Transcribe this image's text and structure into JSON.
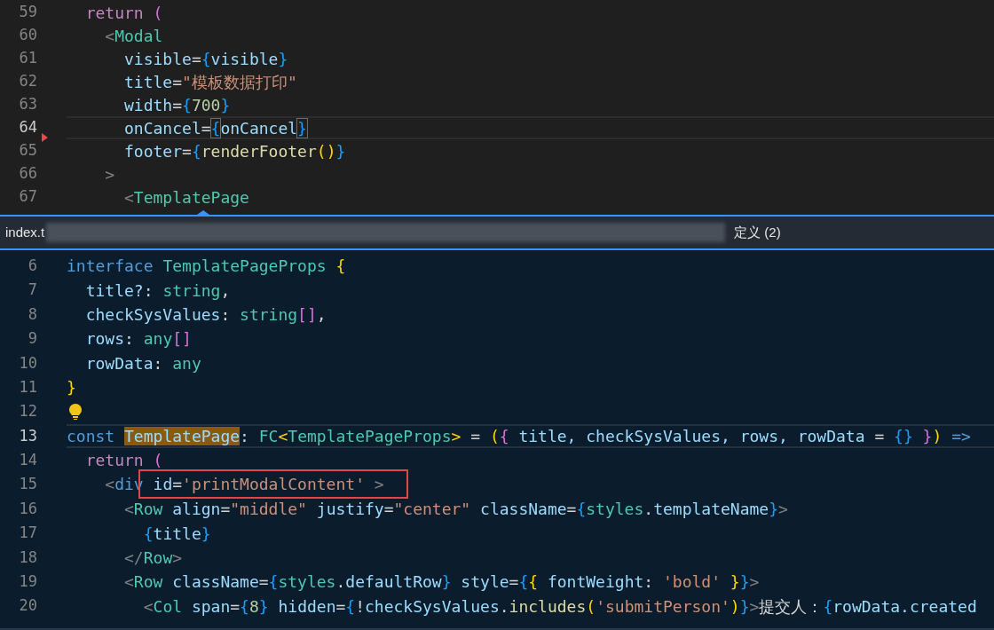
{
  "top_editor": {
    "lines": [
      {
        "number": "59",
        "current": false,
        "tokens": [
          {
            "text": "  return",
            "kind": "kw"
          },
          {
            "text": " (",
            "kind": "b2"
          }
        ]
      },
      {
        "number": "60",
        "current": false,
        "tokens": [
          {
            "text": "    <",
            "kind": "punct"
          },
          {
            "text": "Modal",
            "kind": "tag"
          }
        ]
      },
      {
        "number": "61",
        "current": false,
        "tokens": [
          {
            "text": "      visible",
            "kind": "attr"
          },
          {
            "text": "=",
            "kind": "plain"
          },
          {
            "text": "{",
            "kind": "b3"
          },
          {
            "text": "visible",
            "kind": "var"
          },
          {
            "text": "}",
            "kind": "b3"
          }
        ]
      },
      {
        "number": "62",
        "current": false,
        "tokens": [
          {
            "text": "      title",
            "kind": "attr"
          },
          {
            "text": "=",
            "kind": "plain"
          },
          {
            "text": "\"模板数据打印\"",
            "kind": "str"
          }
        ]
      },
      {
        "number": "63",
        "current": false,
        "tokens": [
          {
            "text": "      width",
            "kind": "attr"
          },
          {
            "text": "=",
            "kind": "plain"
          },
          {
            "text": "{",
            "kind": "b3"
          },
          {
            "text": "700",
            "kind": "num"
          },
          {
            "text": "}",
            "kind": "b3"
          }
        ]
      },
      {
        "number": "64",
        "current": true,
        "deleted_marker": true,
        "tokens": [
          {
            "text": "      onCancel",
            "kind": "attr"
          },
          {
            "text": "=",
            "kind": "plain"
          },
          {
            "text": "{",
            "kind": "b3-match"
          },
          {
            "text": "onCancel",
            "kind": "var"
          },
          {
            "text": "}",
            "kind": "b3-match"
          }
        ]
      },
      {
        "number": "65",
        "current": false,
        "tokens": [
          {
            "text": "      footer",
            "kind": "attr"
          },
          {
            "text": "=",
            "kind": "plain"
          },
          {
            "text": "{",
            "kind": "b3"
          },
          {
            "text": "renderFooter",
            "kind": "fn"
          },
          {
            "text": "(",
            "kind": "b1"
          },
          {
            "text": ")",
            "kind": "b1"
          },
          {
            "text": "}",
            "kind": "b3"
          }
        ]
      },
      {
        "number": "66",
        "current": false,
        "tokens": [
          {
            "text": "    >",
            "kind": "punct"
          }
        ]
      },
      {
        "number": "67",
        "current": false,
        "tokens": [
          {
            "text": "      <",
            "kind": "punct"
          },
          {
            "text": "TemplatePage",
            "kind": "tag"
          }
        ]
      }
    ]
  },
  "peek_header": {
    "file_label": "index.t",
    "title": "定义 (2)"
  },
  "peek_editor": {
    "lines": [
      {
        "number": "6",
        "current": false,
        "tokens": [
          {
            "text": "interface ",
            "kind": "storage"
          },
          {
            "text": "TemplatePageProps ",
            "kind": "type"
          },
          {
            "text": "{",
            "kind": "b1"
          }
        ]
      },
      {
        "number": "7",
        "current": false,
        "tokens": [
          {
            "text": "  title?",
            "kind": "var"
          },
          {
            "text": ": ",
            "kind": "plain"
          },
          {
            "text": "string",
            "kind": "type"
          },
          {
            "text": ",",
            "kind": "plain"
          }
        ]
      },
      {
        "number": "8",
        "current": false,
        "tokens": [
          {
            "text": "  checkSysValues",
            "kind": "var"
          },
          {
            "text": ": ",
            "kind": "plain"
          },
          {
            "text": "string",
            "kind": "type"
          },
          {
            "text": "[]",
            "kind": "b2"
          },
          {
            "text": ",",
            "kind": "plain"
          }
        ]
      },
      {
        "number": "9",
        "current": false,
        "tokens": [
          {
            "text": "  rows",
            "kind": "var"
          },
          {
            "text": ": ",
            "kind": "plain"
          },
          {
            "text": "any",
            "kind": "type"
          },
          {
            "text": "[]",
            "kind": "b2"
          }
        ]
      },
      {
        "number": "10",
        "current": false,
        "tokens": [
          {
            "text": "  rowData",
            "kind": "var"
          },
          {
            "text": ": ",
            "kind": "plain"
          },
          {
            "text": "any",
            "kind": "type"
          }
        ]
      },
      {
        "number": "11",
        "current": false,
        "tokens": [
          {
            "text": "}",
            "kind": "b1"
          }
        ]
      },
      {
        "number": "12",
        "current": false,
        "lightbulb": true
      },
      {
        "number": "13",
        "current": true,
        "tokens": [
          {
            "text": "const ",
            "kind": "storage"
          },
          {
            "text": "TemplatePage",
            "kind": "var-match"
          },
          {
            "text": ": ",
            "kind": "plain"
          },
          {
            "text": "FC",
            "kind": "type"
          },
          {
            "text": "<",
            "kind": "b1"
          },
          {
            "text": "TemplatePageProps",
            "kind": "type"
          },
          {
            "text": ">",
            "kind": "b1"
          },
          {
            "text": " = ",
            "kind": "plain"
          },
          {
            "text": "(",
            "kind": "b1"
          },
          {
            "text": "{",
            "kind": "b2"
          },
          {
            "text": " title, checkSysValues, rows, rowData ",
            "kind": "var"
          },
          {
            "text": "= ",
            "kind": "plain"
          },
          {
            "text": "{}",
            "kind": "b3"
          },
          {
            "text": " }",
            "kind": "b2"
          },
          {
            "text": ")",
            "kind": "b1"
          },
          {
            "text": " =>",
            "kind": "storage"
          }
        ]
      },
      {
        "number": "14",
        "current": false,
        "tokens": [
          {
            "text": "  return",
            "kind": "kw"
          },
          {
            "text": " (",
            "kind": "b2"
          }
        ]
      },
      {
        "number": "15",
        "current": false,
        "tokens": [
          {
            "text": "    <",
            "kind": "punct"
          },
          {
            "text": "div",
            "kind": "storage"
          },
          {
            "text": " id",
            "kind": "attr",
            "boxed": true
          },
          {
            "text": "=",
            "kind": "plain",
            "boxed": true
          },
          {
            "text": "'printModalContent'",
            "kind": "str",
            "boxed": true
          },
          {
            "text": " >  ",
            "kind": "punct",
            "boxed": true
          }
        ]
      },
      {
        "number": "16",
        "current": false,
        "tokens": [
          {
            "text": "      <",
            "kind": "punct"
          },
          {
            "text": "Row",
            "kind": "tag"
          },
          {
            "text": " align",
            "kind": "attr"
          },
          {
            "text": "=",
            "kind": "plain"
          },
          {
            "text": "\"middle\"",
            "kind": "str"
          },
          {
            "text": " justify",
            "kind": "attr"
          },
          {
            "text": "=",
            "kind": "plain"
          },
          {
            "text": "\"center\"",
            "kind": "str"
          },
          {
            "text": " className",
            "kind": "attr"
          },
          {
            "text": "=",
            "kind": "plain"
          },
          {
            "text": "{",
            "kind": "b3"
          },
          {
            "text": "styles",
            "kind": "type"
          },
          {
            "text": ".",
            "kind": "plain"
          },
          {
            "text": "templateName",
            "kind": "var"
          },
          {
            "text": "}",
            "kind": "b3"
          },
          {
            "text": ">",
            "kind": "punct"
          }
        ]
      },
      {
        "number": "17",
        "current": false,
        "tokens": [
          {
            "text": "        {",
            "kind": "b3"
          },
          {
            "text": "title",
            "kind": "var"
          },
          {
            "text": "}",
            "kind": "b3"
          }
        ]
      },
      {
        "number": "18",
        "current": false,
        "tokens": [
          {
            "text": "      </",
            "kind": "punct"
          },
          {
            "text": "Row",
            "kind": "tag"
          },
          {
            "text": ">",
            "kind": "punct"
          }
        ]
      },
      {
        "number": "19",
        "current": false,
        "tokens": [
          {
            "text": "      <",
            "kind": "punct"
          },
          {
            "text": "Row",
            "kind": "tag"
          },
          {
            "text": " className",
            "kind": "attr"
          },
          {
            "text": "=",
            "kind": "plain"
          },
          {
            "text": "{",
            "kind": "b3"
          },
          {
            "text": "styles",
            "kind": "type"
          },
          {
            "text": ".",
            "kind": "plain"
          },
          {
            "text": "defaultRow",
            "kind": "var"
          },
          {
            "text": "}",
            "kind": "b3"
          },
          {
            "text": " style",
            "kind": "attr"
          },
          {
            "text": "=",
            "kind": "plain"
          },
          {
            "text": "{",
            "kind": "b3"
          },
          {
            "text": "{",
            "kind": "b1"
          },
          {
            "text": " fontWeight",
            "kind": "var"
          },
          {
            "text": ": ",
            "kind": "plain"
          },
          {
            "text": "'bold' ",
            "kind": "str"
          },
          {
            "text": "}",
            "kind": "b1"
          },
          {
            "text": "}",
            "kind": "b3"
          },
          {
            "text": ">",
            "kind": "punct"
          }
        ]
      },
      {
        "number": "20",
        "current": false,
        "tokens": [
          {
            "text": "        <",
            "kind": "punct"
          },
          {
            "text": "Col",
            "kind": "tag"
          },
          {
            "text": " span",
            "kind": "attr"
          },
          {
            "text": "=",
            "kind": "plain"
          },
          {
            "text": "{",
            "kind": "b3"
          },
          {
            "text": "8",
            "kind": "num"
          },
          {
            "text": "}",
            "kind": "b3"
          },
          {
            "text": " hidden",
            "kind": "attr"
          },
          {
            "text": "=",
            "kind": "plain"
          },
          {
            "text": "{",
            "kind": "b3"
          },
          {
            "text": "!",
            "kind": "plain"
          },
          {
            "text": "checkSysValues",
            "kind": "var"
          },
          {
            "text": ".",
            "kind": "plain"
          },
          {
            "text": "includes",
            "kind": "fn"
          },
          {
            "text": "(",
            "kind": "b1"
          },
          {
            "text": "'submitPerson'",
            "kind": "str"
          },
          {
            "text": ")",
            "kind": "b1"
          },
          {
            "text": "}",
            "kind": "b3"
          },
          {
            "text": ">",
            "kind": "punct"
          },
          {
            "text": "提交人：",
            "kind": "text"
          },
          {
            "text": "{",
            "kind": "b3"
          },
          {
            "text": "rowData",
            "kind": "var"
          },
          {
            "text": ".created",
            "kind": "var"
          }
        ]
      }
    ]
  }
}
